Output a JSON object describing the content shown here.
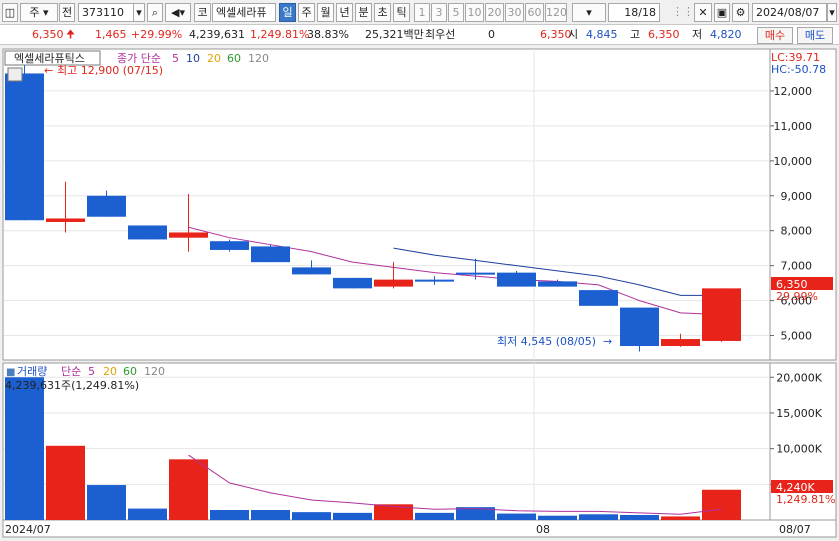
{
  "toolbar": {
    "period_sel": "주",
    "prev_label": "전",
    "code": "373110",
    "kospi_btn": "코",
    "stock_name": "엑셀세라퓨",
    "periods": [
      "일",
      "주",
      "월",
      "년",
      "분",
      "초",
      "틱"
    ],
    "numbers": [
      "1",
      "3",
      "5",
      "10",
      "20",
      "30",
      "60",
      "120"
    ],
    "page": "18/18",
    "date": "2024/08/07"
  },
  "quote": {
    "price": "6,350",
    "change": "1,465",
    "change_pct": "+29.99%",
    "volume": "4,239,631",
    "vol_ratio": "1,249.81%",
    "turnover": "38.83%",
    "amount": "25,321백만",
    "bid_label": "최우선",
    "bid_qty": "0",
    "bid_price": "6,350",
    "open_label": "시",
    "open": "4,845",
    "high_label": "고",
    "high": "6,350",
    "low_label": "저",
    "low": "4,820",
    "buy": "매수",
    "sell": "매도"
  },
  "price_panel": {
    "title": "엑셀세라퓨틱스",
    "legend_label": "종가 단순",
    "legend_ma": [
      "5",
      "10",
      "20",
      "60",
      "120"
    ],
    "lc": "LC:39.71",
    "hc": "HC:-50.78",
    "max_note": "최고 12,900 (07/15)",
    "min_note": "최저 4,545 (08/05)",
    "cur_price": "6,350",
    "cur_pct": "29.99%",
    "y_ticks": [
      "12,000",
      "11,000",
      "10,000",
      "9,000",
      "8,000",
      "7,000",
      "6,000",
      "5,000"
    ]
  },
  "volume_panel": {
    "title": "거래량",
    "legend_label": "단순",
    "legend_ma": [
      "5",
      "20",
      "60",
      "120"
    ],
    "vol_text": "4,239,631주(1,249.81%)",
    "y_ticks": [
      "20,000K",
      "15,000K",
      "10,000K",
      "5,000K"
    ],
    "cur_vol": "4,240K",
    "cur_pct": "1,249.81%"
  },
  "x_axis": {
    "start": "2024/07",
    "mid": "08",
    "end": "08/07"
  },
  "colors": {
    "up": "#e8241a",
    "down": "#1c5fd0",
    "ma5": "#b0309c",
    "ma10": "#1d3f9c"
  },
  "chart_data": {
    "type": "candlestick",
    "candles": [
      {
        "open": 12500,
        "high": 12900,
        "low": 8300,
        "close": 8300
      },
      {
        "open": 8250,
        "high": 9400,
        "low": 7950,
        "close": 8350
      },
      {
        "open": 9000,
        "high": 9150,
        "low": 8400,
        "close": 8400
      },
      {
        "open": 8150,
        "high": 8150,
        "low": 7750,
        "close": 7750
      },
      {
        "open": 7800,
        "high": 9050,
        "low": 7400,
        "close": 7950
      },
      {
        "open": 7700,
        "high": 7750,
        "low": 7400,
        "close": 7450
      },
      {
        "open": 7550,
        "high": 7600,
        "low": 7100,
        "close": 7100
      },
      {
        "open": 6950,
        "high": 7150,
        "low": 6750,
        "close": 6750
      },
      {
        "open": 6650,
        "high": 6650,
        "low": 6350,
        "close": 6350
      },
      {
        "open": 6400,
        "high": 7100,
        "low": 6350,
        "close": 6600
      },
      {
        "open": 6600,
        "high": 6700,
        "low": 6450,
        "close": 6600
      },
      {
        "open": 6800,
        "high": 7200,
        "low": 6600,
        "close": 6750
      },
      {
        "open": 6800,
        "high": 6850,
        "low": 6400,
        "close": 6400
      },
      {
        "open": 6550,
        "high": 6600,
        "low": 6400,
        "close": 6400
      },
      {
        "open": 6300,
        "high": 6300,
        "low": 5850,
        "close": 5850
      },
      {
        "open": 5800,
        "high": 5800,
        "low": 4545,
        "close": 4700
      },
      {
        "open": 4700,
        "high": 5050,
        "low": 4680,
        "close": 4900
      },
      {
        "open": 4845,
        "high": 6350,
        "low": 4820,
        "close": 6350
      }
    ],
    "ma5": [
      null,
      null,
      null,
      null,
      8100,
      7800,
      7600,
      7400,
      7100,
      6950,
      6800,
      6700,
      6600,
      6550,
      6450,
      6000,
      5650,
      5600
    ],
    "ma10": [
      null,
      null,
      null,
      null,
      null,
      null,
      null,
      null,
      null,
      7500,
      7300,
      7150,
      7000,
      6850,
      6700,
      6450,
      6150,
      6150
    ],
    "volumes": [
      20000,
      10400,
      4900,
      1600,
      8500,
      1400,
      1400,
      1100,
      1000,
      2200,
      1000,
      1800,
      900,
      600,
      800,
      700,
      500,
      4240
    ],
    "volume_ma5": [
      null,
      null,
      null,
      null,
      9100,
      5200,
      3800,
      2800,
      2400,
      1900,
      1500,
      1600,
      1300,
      1200,
      1200,
      1000,
      800,
      1500
    ],
    "up_flags": [
      false,
      true,
      false,
      false,
      true,
      false,
      false,
      false,
      false,
      true,
      false,
      false,
      false,
      false,
      false,
      false,
      true,
      true
    ],
    "price_range": [
      4300,
      13200
    ],
    "volume_range": [
      0,
      22000
    ]
  }
}
